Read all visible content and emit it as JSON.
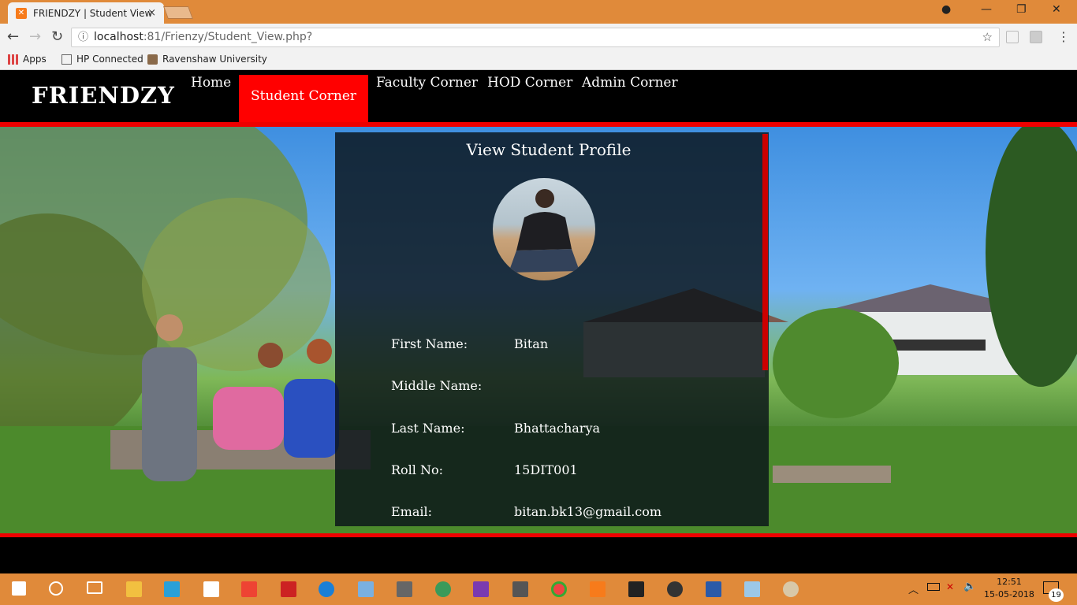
{
  "browser": {
    "tab_title": "FRIENDZY | Student View",
    "tab_close": "×",
    "url_host": "localhost",
    "url_rest": ":81/Frienzy/Student_View.php?",
    "bookmarks": [
      "Apps",
      "HP Connected",
      "Ravenshaw University"
    ]
  },
  "site": {
    "logo": "FRIENDZY",
    "nav": [
      "Home",
      "Student Corner",
      "Faculty Corner",
      "HOD Corner",
      "Admin Corner"
    ]
  },
  "profile": {
    "title": "View Student Profile",
    "fields": [
      {
        "label": "First Name:",
        "value": "Bitan"
      },
      {
        "label": "Middle Name:",
        "value": ""
      },
      {
        "label": "Last Name:",
        "value": "Bhattacharya"
      },
      {
        "label": "Roll No:",
        "value": "15DIT001"
      },
      {
        "label": "Email:",
        "value": "bitan.bk13@gmail.com"
      }
    ]
  },
  "taskbar": {
    "time": "12:51",
    "date": "15-05-2018",
    "notifications": "19"
  },
  "colors": {
    "accent": "#ff0000",
    "header_bg": "#000000",
    "chrome": "#e08a3a"
  }
}
